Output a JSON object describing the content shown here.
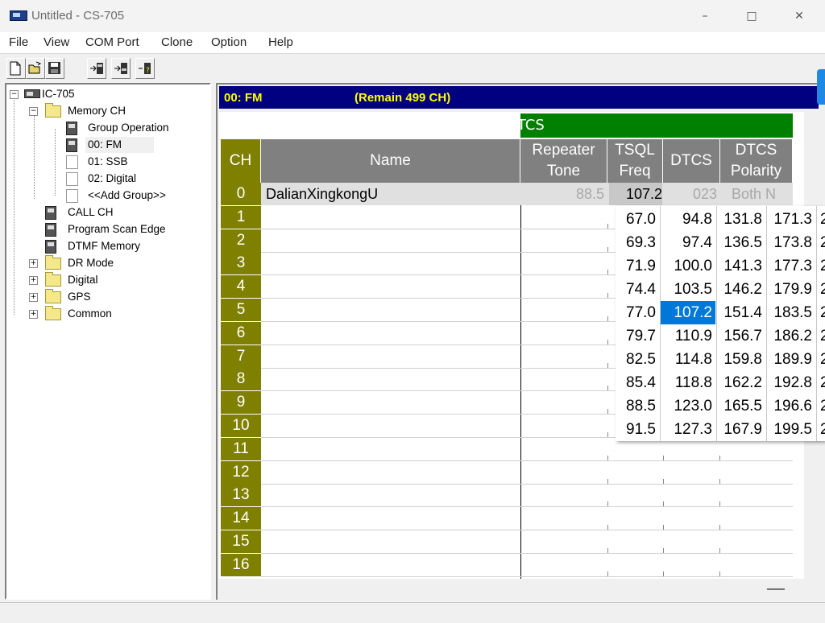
{
  "window": {
    "title": "Untitled - CS-705"
  },
  "controls": {
    "minimize": "–",
    "maximize": "□",
    "close": "✕"
  },
  "menu": [
    "File",
    "View",
    "COM Port",
    "Clone",
    "Option",
    "Help"
  ],
  "toolbar": {
    "buttons": [
      "new-file-icon",
      "open-folder-icon",
      "save-disk-icon",
      "write-to-radio-icon",
      "read-from-radio-icon",
      "radio-info-icon"
    ]
  },
  "tree": {
    "root": "IC-705",
    "memory_ch": "Memory CH",
    "memory_children": [
      "Group Operation",
      "00: FM",
      "01: SSB",
      "02: Digital",
      "<<Add Group>>"
    ],
    "call_ch": "CALL CH",
    "program_scan_edge": "Program Scan Edge",
    "dtmf_memory": "DTMF Memory",
    "folders": [
      "DR Mode",
      "Digital",
      "GPS",
      "Common"
    ]
  },
  "mode_bar": {
    "group": "00: FM",
    "remain": "(Remain  499 CH)"
  },
  "table": {
    "band_label": "DTCS",
    "headers": {
      "ch": "CH",
      "name": "Name",
      "repeater_tone_1": "Repeater",
      "repeater_tone_2": "Tone",
      "tsql_freq_1": "TSQL",
      "tsql_freq_2": "Freq",
      "dtcs": "DTCS",
      "dtcs_polarity_1": "DTCS",
      "dtcs_polarity_2": "Polarity"
    },
    "rows": [
      "0",
      "1",
      "2",
      "3",
      "4",
      "5",
      "6",
      "7",
      "8",
      "9",
      "10",
      "11",
      "12",
      "13",
      "14",
      "15",
      "16"
    ],
    "row0": {
      "name": "DalianXingkongU",
      "repeater_tone": "88.5",
      "tsql_freq": "107.2",
      "dtcs": "023",
      "polarity": "Both N"
    }
  },
  "tone_popup": {
    "columns": [
      [
        "67.0",
        "69.3",
        "71.9",
        "74.4",
        "77.0",
        "79.7",
        "82.5",
        "85.4",
        "88.5",
        "91.5"
      ],
      [
        "94.8",
        "97.4",
        "100.0",
        "103.5",
        "107.2",
        "110.9",
        "114.8",
        "118.8",
        "123.0",
        "127.3"
      ],
      [
        "131.8",
        "136.5",
        "141.3",
        "146.2",
        "151.4",
        "156.7",
        "159.8",
        "162.2",
        "165.5",
        "167.9"
      ],
      [
        "171.3",
        "173.8",
        "177.3",
        "179.9",
        "183.5",
        "186.2",
        "189.9",
        "192.8",
        "196.6",
        "199.5"
      ],
      [
        "2",
        "2",
        "2",
        "2",
        "2",
        "2",
        "2",
        "2",
        "2",
        "2"
      ]
    ],
    "selected": "107.2"
  }
}
